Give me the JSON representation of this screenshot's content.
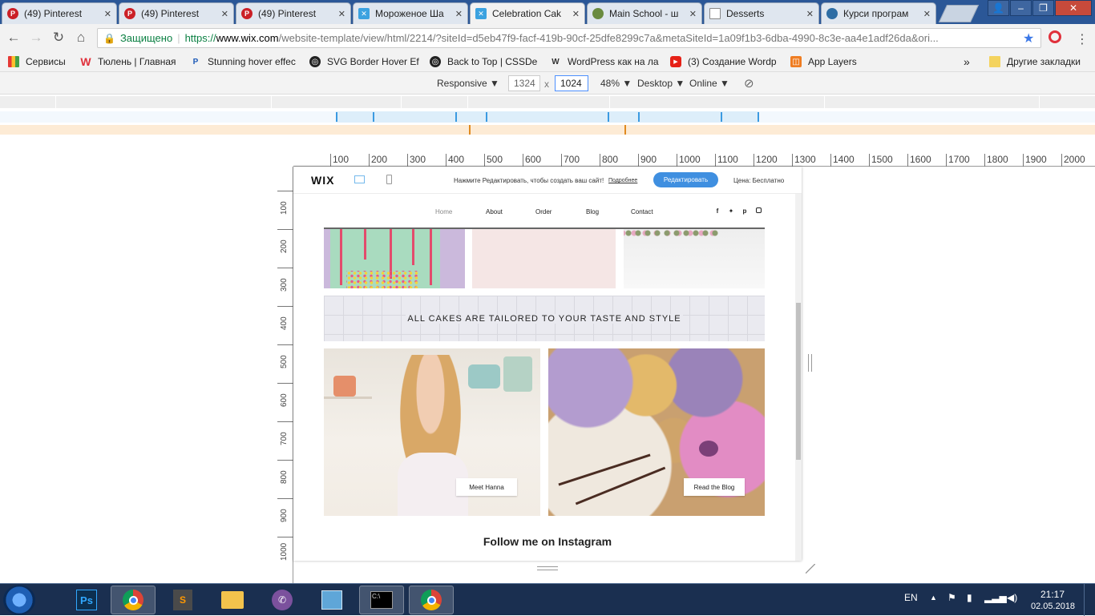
{
  "tabs": [
    {
      "label": "(49) Pinterest",
      "icon": "pinterest-icon",
      "color": "#cb2027"
    },
    {
      "label": "(49) Pinterest",
      "icon": "pinterest-icon",
      "color": "#cb2027"
    },
    {
      "label": "(49) Pinterest",
      "icon": "pinterest-icon",
      "color": "#cb2027"
    },
    {
      "label": "Мороженое Ша",
      "icon": "wix-icon",
      "color": "#3ba2e0"
    },
    {
      "label": "Celebration Cak",
      "icon": "wix-icon",
      "color": "#3ba2e0"
    },
    {
      "label": "Main School - ш",
      "icon": "globe-icon",
      "color": "#6a8b3f"
    },
    {
      "label": "Desserts",
      "icon": "page-icon",
      "color": "#888888"
    },
    {
      "label": "Курси програм",
      "icon": "globe-icon",
      "color": "#2e6da4"
    }
  ],
  "address": {
    "secure_label": "Защищено",
    "url_prefix": "https://",
    "url_host": "www.wix.com",
    "url_path": "/website-template/view/html/2214/?siteId=d5eb47f9-facf-419b-90cf-25dfe8299c7a&metaSiteId=1a09f1b3-6dba-4990-8c3e-aa4e1adf26da&ori..."
  },
  "bookmarks": {
    "apps": "Сервисы",
    "items": [
      "Тюлень | Главная",
      "Stunning hover effec",
      "SVG Border Hover Ef",
      "Back to Top | CSSDe",
      "WordPress как на ла",
      "(3) Создание Wordp",
      "App Layers"
    ],
    "more": "»",
    "other": "Другие закладки"
  },
  "devtools": {
    "mode": "Responsive",
    "width": "1324",
    "times": "x",
    "height": "1024",
    "zoom": "48%",
    "device": "Desktop",
    "network": "Online"
  },
  "ruler_h": [
    "100",
    "200",
    "300",
    "400",
    "500",
    "600",
    "700",
    "800",
    "900",
    "1000",
    "1100",
    "1200",
    "1300",
    "1400",
    "1500",
    "1600",
    "1700",
    "1800",
    "1900",
    "2000"
  ],
  "ruler_v": [
    "100",
    "200",
    "300",
    "400",
    "500",
    "600",
    "700",
    "800",
    "900",
    "1000"
  ],
  "wix_bar": {
    "logo": "WIX",
    "prompt": "Нажмите Редактировать, чтобы создать ваш сайт!",
    "learn_more": "Подробнее",
    "edit_button": "Редактировать",
    "price": "Цена: Бесплатно"
  },
  "site_nav": [
    "Home",
    "About",
    "Order",
    "Blog",
    "Contact"
  ],
  "banner_text": "ALL CAKES ARE TAILORED TO YOUR TASTE AND STYLE",
  "card_left_button": "Meet Hanna",
  "card_right_button": "Read the Blog",
  "instagram_heading": "Follow me on Instagram",
  "tray": {
    "lang": "EN",
    "time": "21:17",
    "date": "02.05.2018"
  }
}
